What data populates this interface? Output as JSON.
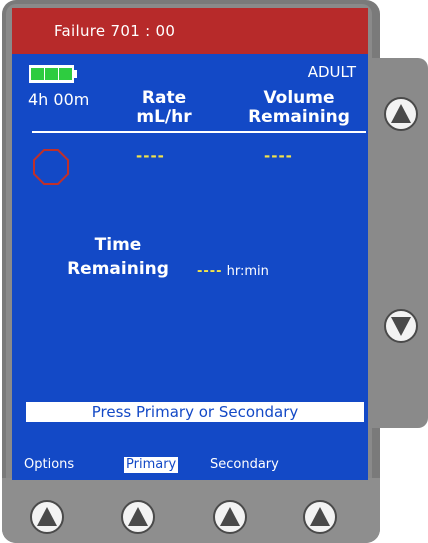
{
  "header": {
    "title": "Failure 701 : 00"
  },
  "status": {
    "battery_icon": "battery-full-icon",
    "mode": "ADULT",
    "time": "4h 00m"
  },
  "columns": {
    "rate_line1": "Rate",
    "rate_line2": "mL/hr",
    "volume_line1": "Volume",
    "volume_line2": "Remaining"
  },
  "values": {
    "rate": "----",
    "volume": "----"
  },
  "time_remaining": {
    "label_line1": "Time",
    "label_line2": "Remaining",
    "value": "----",
    "unit": "hr:min"
  },
  "prompt": "Press Primary or Secondary",
  "softkeys": {
    "options": "Options",
    "primary": "Primary",
    "secondary": "Secondary"
  },
  "icons": {
    "stop": "stop-octagon-icon",
    "up": "arrow-up-icon",
    "down": "arrow-down-icon"
  },
  "colors": {
    "screen": "#1349c6",
    "title_bar": "#b72a2a",
    "value_dashes": "#f3e34a",
    "battery": "#2ecc40"
  }
}
